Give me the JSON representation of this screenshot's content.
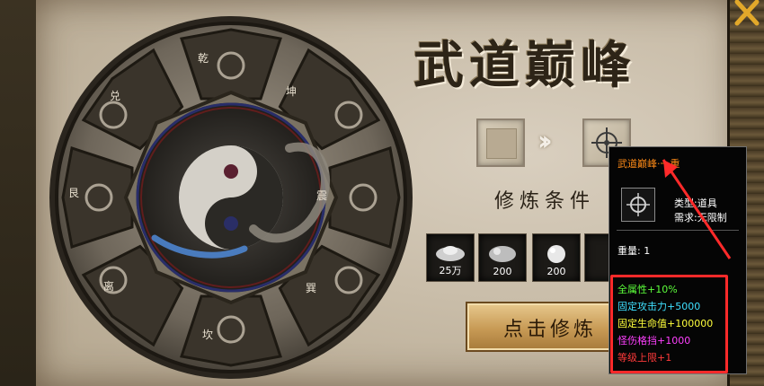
{
  "title": "武道巅峰",
  "trigrams": [
    "乾",
    "坤",
    "震",
    "巽",
    "坎",
    "离",
    "艮",
    "兑"
  ],
  "condition_label": "修炼条件",
  "materials": [
    {
      "qty": "25万"
    },
    {
      "qty": "200"
    },
    {
      "qty": "200"
    }
  ],
  "button_label": "点击修炼",
  "tooltip": {
    "name": "武道巅峰·一重",
    "type_line": "类型:道具",
    "need_line": "需求:无限制",
    "weight_line": "重量: 1",
    "stats": [
      {
        "text": "全属性+10%",
        "color": "#5dff3b"
      },
      {
        "text": "固定攻击力+5000",
        "color": "#3fe0ff"
      },
      {
        "text": "固定生命值+100000",
        "color": "#ffff3c"
      },
      {
        "text": "怪伤格挡+1000",
        "color": "#ff40ff"
      },
      {
        "text": "等级上限+1",
        "color": "#ff3a3a"
      }
    ]
  },
  "colors": {
    "annotation": "#ff2a2a",
    "accent_gold": "#e2a82a"
  }
}
